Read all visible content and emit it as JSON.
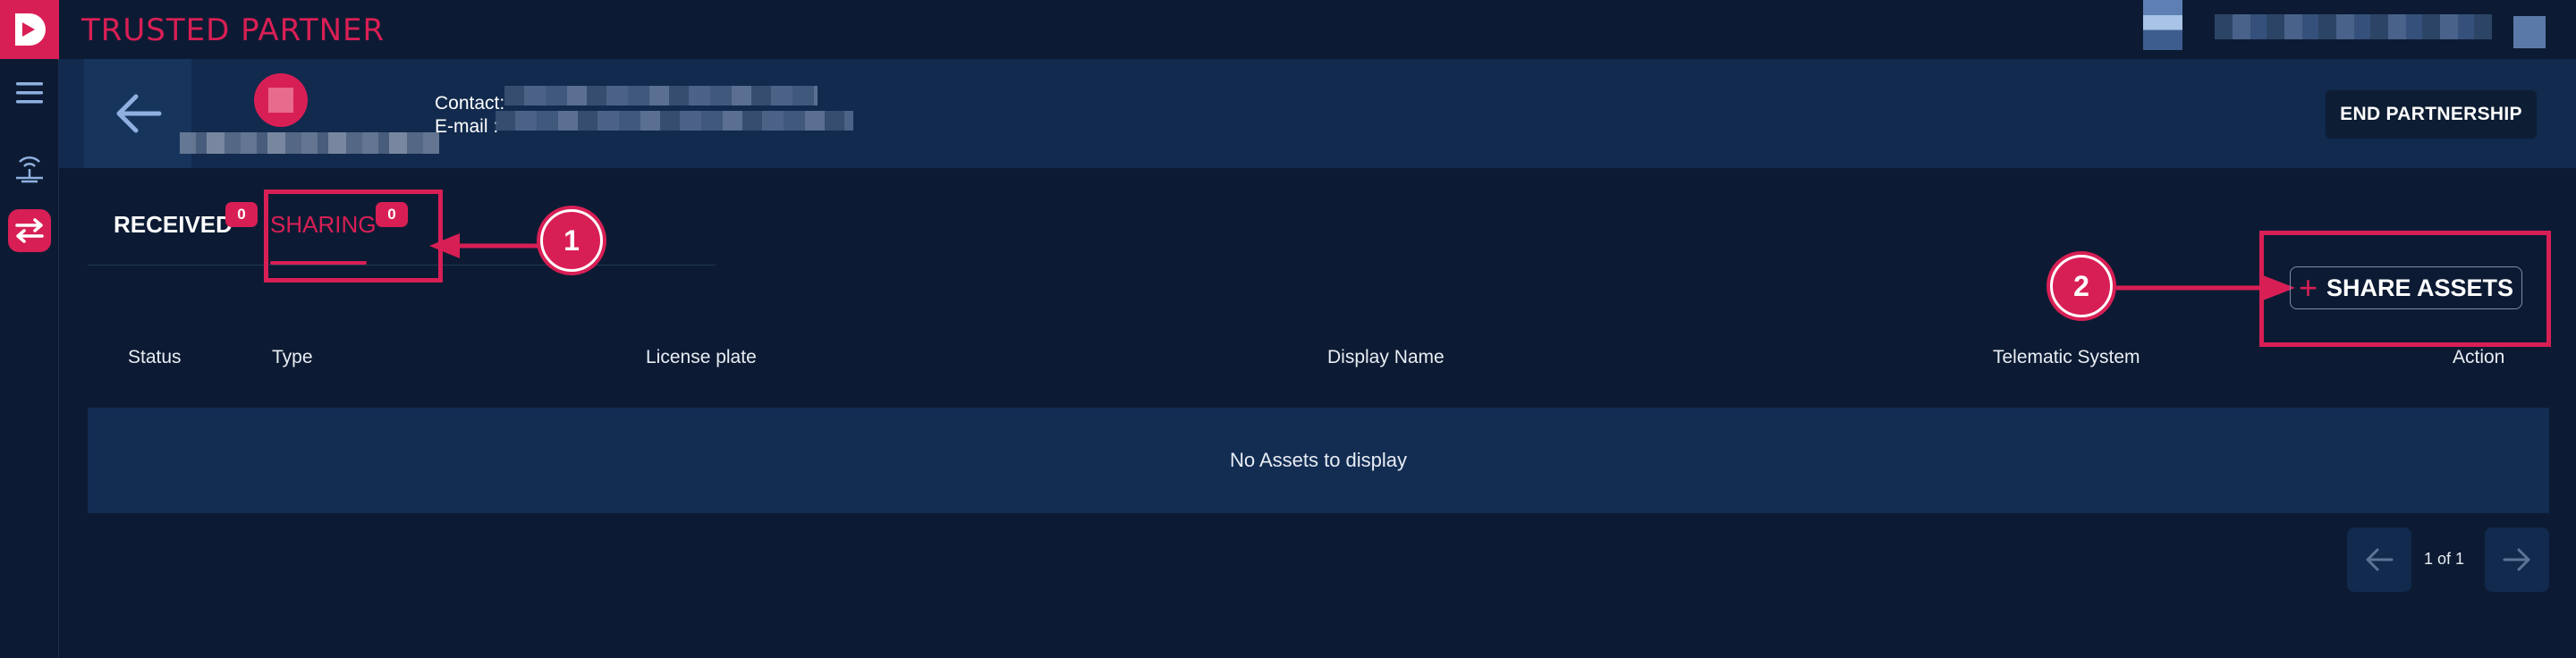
{
  "app": {
    "title": "TRUSTED PARTNER"
  },
  "partner": {
    "contact_label": "Contact:",
    "email_label": "E-mail :",
    "end_button": "END PARTNERSHIP"
  },
  "tabs": [
    {
      "label": "RECEIVED",
      "count": "0"
    },
    {
      "label": "SHARING",
      "count": "0"
    }
  ],
  "share_button": {
    "label": "SHARE ASSETS"
  },
  "table": {
    "columns": [
      "Status",
      "Type",
      "License plate",
      "Display Name",
      "Telematic System",
      "Action"
    ],
    "empty_text": "No Assets to display"
  },
  "pagination": {
    "text": "1 of 1"
  },
  "annotations": [
    "1",
    "2"
  ],
  "colors": {
    "accent": "#d81f55",
    "background": "#0c1b33",
    "band": "#112a4d"
  },
  "icons": [
    "logo-icon",
    "menu-icon",
    "telematics-icon",
    "swap-icon",
    "back-arrow-icon",
    "plus-icon",
    "arrow-left-icon",
    "arrow-right-icon"
  ]
}
